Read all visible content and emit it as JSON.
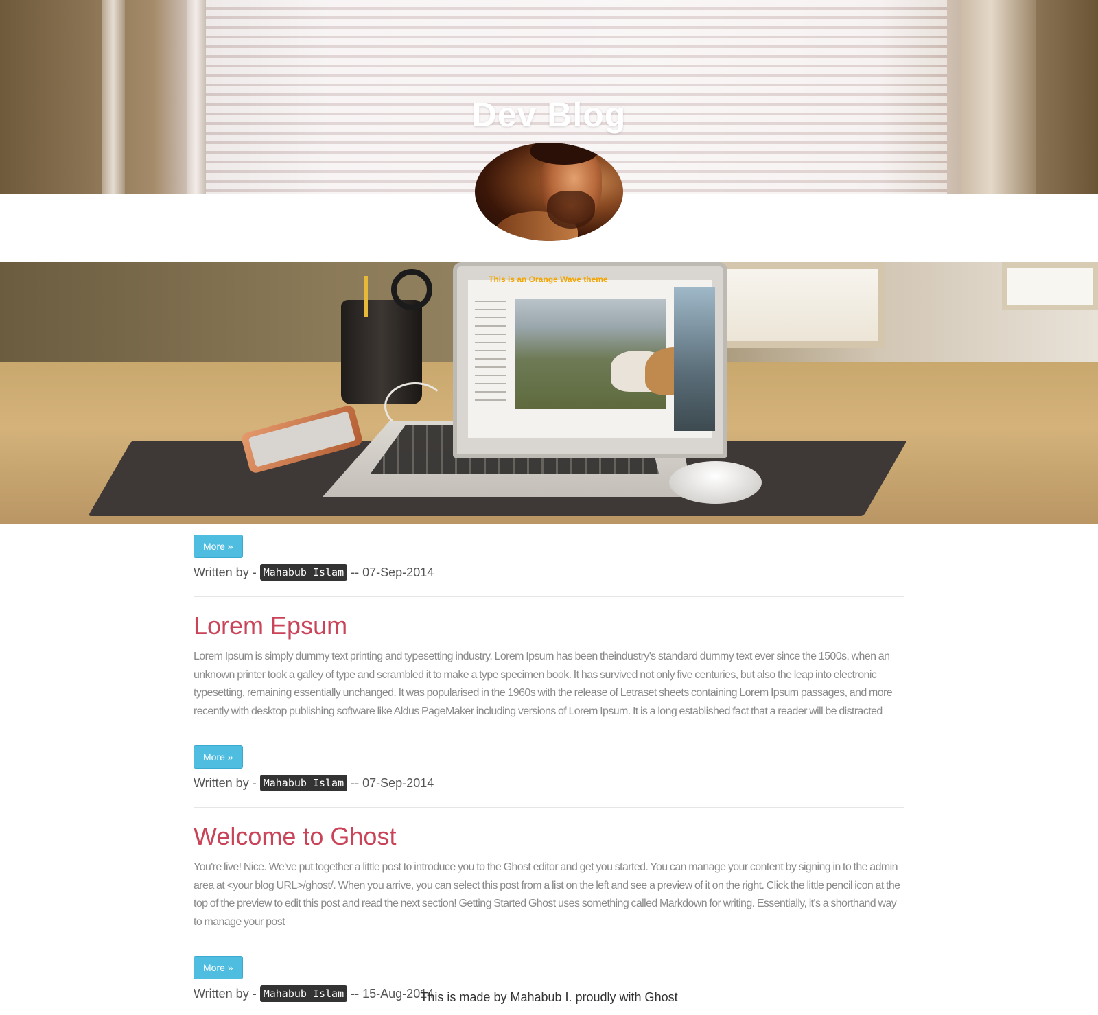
{
  "site": {
    "title": "Dev Blog",
    "feature_caption": "This is an Orange Wave theme"
  },
  "first_entry": {
    "more_label": "More »",
    "written_by": "Written by -",
    "author": "Mahabub Islam",
    "separator": "--",
    "date": "07-Sep-2014"
  },
  "posts": [
    {
      "title": "Lorem Epsum",
      "excerpt": "Lorem Ipsum is simply dummy text printing and typesetting industry. Lorem Ipsum has been theindustry's standard dummy text ever since the 1500s, when an unknown printer took a galley of type and scrambled it to make a type specimen book. It has survived not only five centuries, but also the leap into electronic typesetting, remaining essentially unchanged. It was popularised in the 1960s with the release of Letraset sheets containing Lorem Ipsum passages, and more recently with desktop publishing software like Aldus PageMaker including versions of Lorem Ipsum. It is a long established fact that a reader will be distracted",
      "more_label": "More »",
      "written_by": "Written by -",
      "author": "Mahabub Islam",
      "separator": "--",
      "date": "07-Sep-2014"
    },
    {
      "title": "Welcome to Ghost",
      "excerpt": "You're live! Nice. We've put together a little post to introduce you to the Ghost editor and get you started. You can manage your content by signing in to the admin area at <your blog URL>/ghost/. When you arrive, you can select this post from a list on the left and see a preview of it on the right. Click the little pencil icon at the top of the preview to edit this post and read the next section! Getting Started Ghost uses something called Markdown for writing. Essentially, it's a shorthand way to manage your post",
      "more_label": "More »",
      "written_by": "Written by -",
      "author": "Mahabub Islam",
      "separator": "--",
      "date": "15-Aug-2014"
    }
  ],
  "footer": {
    "text": "This is made by Mahabub I. proudly with Ghost"
  },
  "colors": {
    "accent_button": "#4ebde0",
    "post_title": "#c94459",
    "excerpt": "#8a8a8a",
    "feature_caption": "#f3a500"
  }
}
